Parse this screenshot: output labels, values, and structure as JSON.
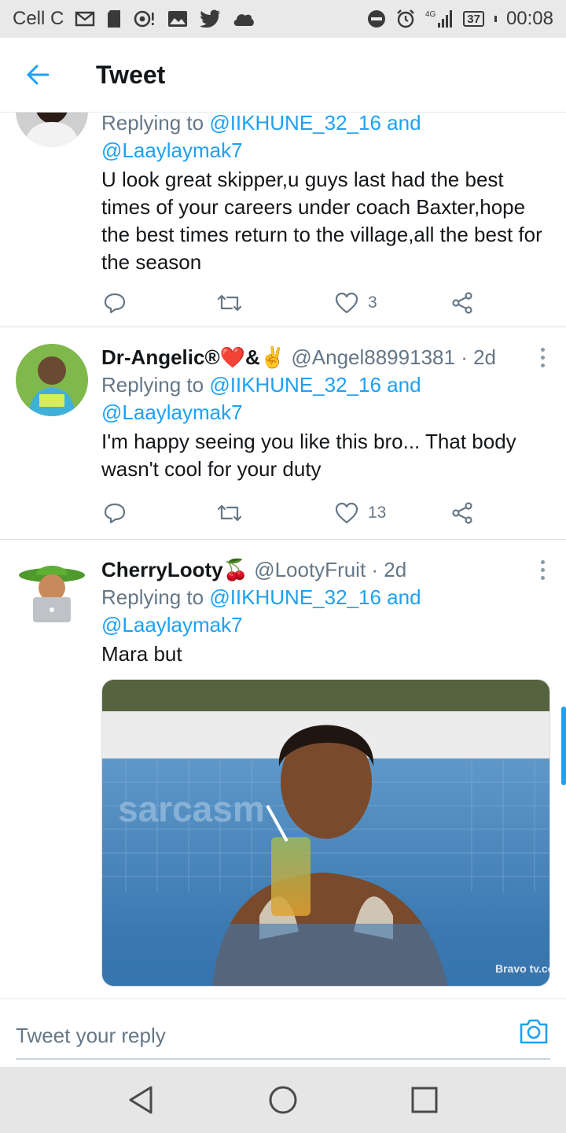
{
  "status_bar": {
    "carrier": "Cell C",
    "network": "4G",
    "battery": "37",
    "time": "00:08"
  },
  "header": {
    "title": "Tweet"
  },
  "tweets": [
    {
      "reply_prefix": "Replying to",
      "reply_mention_1": "@IIKHUNE_32_16",
      "reply_and": "and",
      "reply_mention_2": "@Laaylaymak7",
      "text": "U look great skipper,u guys last had the best times of your careers under coach Baxter,hope the best times return to the village,all the best for the season",
      "likes": "3"
    },
    {
      "name": "Dr-Angelic®❤️&✌️",
      "handle": "@Angel88991381",
      "time": "· 2d",
      "reply_prefix": "Replying to",
      "reply_mention_1": "@IIKHUNE_32_16",
      "reply_and": "and",
      "reply_mention_2": "@Laaylaymak7",
      "text": "I'm happy seeing you like this bro... That body wasn't cool for your duty",
      "likes": "13"
    },
    {
      "name": "CherryLooty🍒",
      "handle": "@LootyFruit",
      "time": "· 2d",
      "reply_prefix": "Replying to",
      "reply_mention_1": "@IIKHUNE_32_16",
      "reply_and": "and",
      "reply_mention_2": "@Laaylaymak7",
      "text": "Mara but",
      "media_watermark": "Bravo tv.com",
      "media_overlay": "sarcasm"
    }
  ],
  "composer": {
    "placeholder": "Tweet your reply"
  },
  "colors": {
    "accent": "#1da1f2",
    "secondary_text": "#657786",
    "primary_text": "#14171a",
    "like_heart": "#657786"
  },
  "icons": [
    "arrow-left-icon",
    "reply-icon",
    "retweet-icon",
    "heart-icon",
    "share-icon",
    "more-icon",
    "camera-icon",
    "back-triangle-icon",
    "home-circle-icon",
    "recents-square-icon"
  ]
}
